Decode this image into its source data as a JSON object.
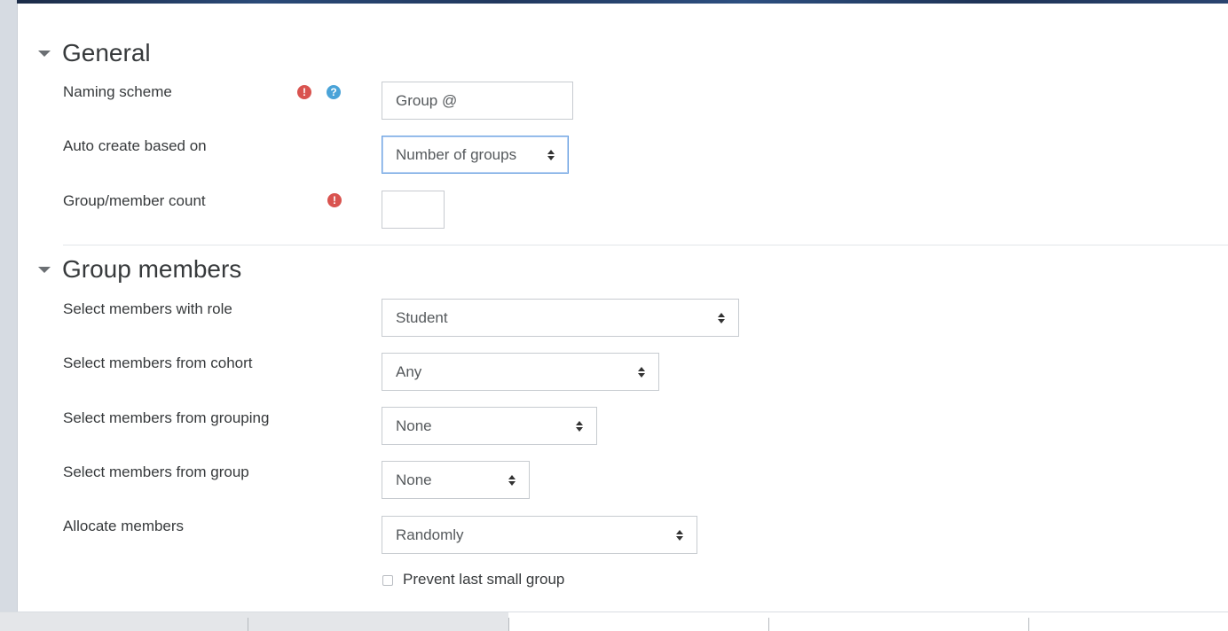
{
  "sections": {
    "general": {
      "title": "General",
      "naming_scheme_label": "Naming scheme",
      "naming_scheme_value": "Group @",
      "auto_create_label": "Auto create based on",
      "auto_create_value": "Number of groups",
      "count_label": "Group/member count",
      "count_value": ""
    },
    "group_members": {
      "title": "Group members",
      "role_label": "Select members with role",
      "role_value": "Student",
      "cohort_label": "Select members from cohort",
      "cohort_value": "Any",
      "grouping_label": "Select members from grouping",
      "grouping_value": "None",
      "group_label": "Select members from group",
      "group_value": "None",
      "allocate_label": "Allocate members",
      "allocate_value": "Randomly",
      "prevent_label": "Prevent last small group",
      "prevent_checked": false
    }
  },
  "icons": {
    "required": "exclamation-circle-icon",
    "help": "question-circle-icon",
    "required_color": "#d9534f",
    "help_color": "#4aa3d8"
  },
  "glyphs": {
    "required": "!",
    "help": "?"
  }
}
